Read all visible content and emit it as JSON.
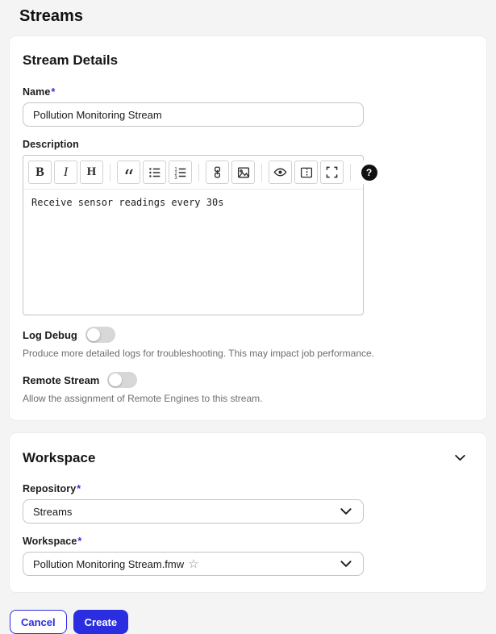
{
  "page": {
    "title": "Streams"
  },
  "colors": {
    "accent": "#2b2ee0",
    "background": "#f4f4f4",
    "card": "#ffffff"
  },
  "stream_details": {
    "heading": "Stream Details",
    "name": {
      "label": "Name",
      "required_mark": "*",
      "value": "Pollution Monitoring Stream"
    },
    "description": {
      "label": "Description",
      "value": "Receive sensor readings every 30s",
      "toolbar": {
        "bold_label": "B",
        "italic_label": "I",
        "heading_label": "H",
        "quote_glyph": "“",
        "guide_glyph": "?",
        "icons": [
          "bold",
          "italic",
          "heading",
          "quote",
          "unordered-list",
          "ordered-list",
          "link",
          "image",
          "preview",
          "side-by-side",
          "fullscreen",
          "guide"
        ]
      }
    },
    "log_debug": {
      "label": "Log Debug",
      "enabled": false,
      "help": "Produce more detailed logs for troubleshooting. This may impact job performance."
    },
    "remote_stream": {
      "label": "Remote Stream",
      "enabled": false,
      "help": "Allow the assignment of Remote Engines to this stream."
    }
  },
  "workspace_section": {
    "heading": "Workspace",
    "collapse_icon": "chevron-down-icon",
    "repository": {
      "label": "Repository",
      "required_mark": "*",
      "value": "Streams"
    },
    "workspace": {
      "label": "Workspace",
      "required_mark": "*",
      "value": "Pollution Monitoring Stream.fmw",
      "favorite_icon": "star-outline-icon",
      "star_glyph": "☆"
    }
  },
  "footer": {
    "cancel_label": "Cancel",
    "create_label": "Create"
  }
}
